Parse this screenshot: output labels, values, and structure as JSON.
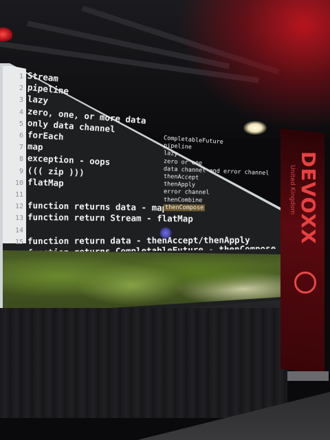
{
  "editor": {
    "line_numbers": [
      "1",
      "2",
      "3",
      "4",
      "5",
      "6",
      "7",
      "8",
      "9",
      "10",
      "11",
      "12",
      "13",
      "14",
      "15"
    ],
    "left_lines": [
      "Stream",
      "pipeline",
      "lazy",
      "zero, one, or more data",
      "only data channel",
      "forEach",
      "map",
      "exception - oops",
      "(((  zip  )))",
      "flatMap",
      "",
      "function returns data - map",
      "function return Stream - flatMap",
      "",
      "function return data - thenAccept/thenApply"
    ],
    "right_lines": [
      "CompletableFuture",
      "pipeline",
      "lazy",
      "zero or one",
      "data channel and error channel",
      "thenAccept",
      "thenApply",
      "error channel",
      "thenCombine",
      "thenCompose"
    ],
    "cut_off_line": "function returns CompletableFuture - thenCompose"
  },
  "banner": {
    "title": "DEVOXX",
    "subtitle": "United Kingdom"
  },
  "colors": {
    "accent_red": "#e84040",
    "editor_bg": "#1d1f21",
    "highlight": "#6b5a2e"
  }
}
